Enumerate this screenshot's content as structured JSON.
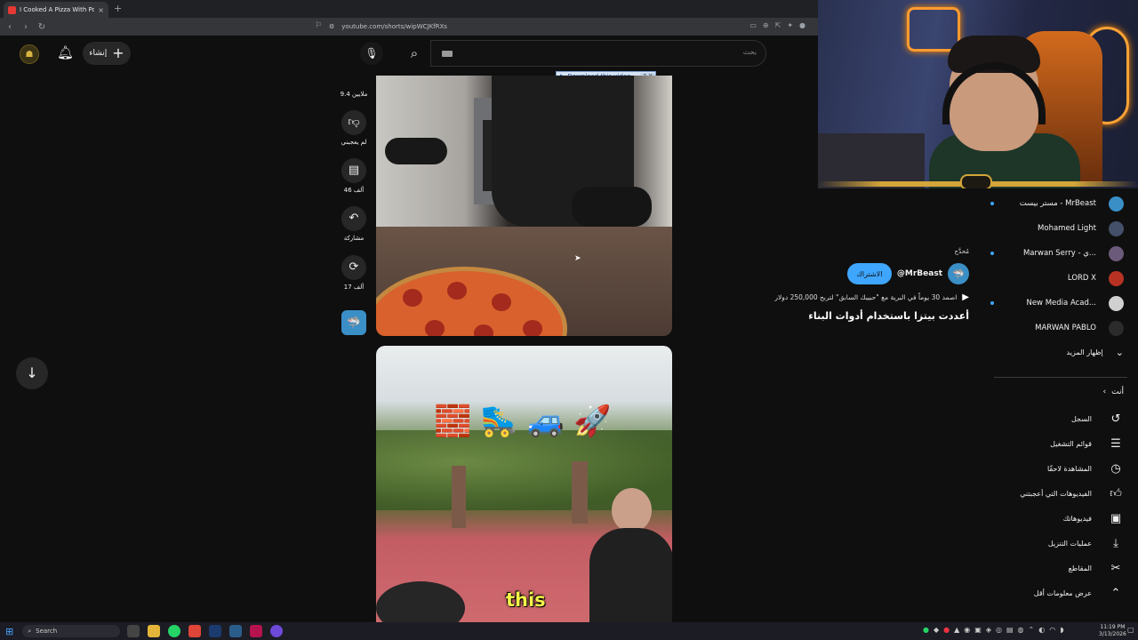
{
  "browser": {
    "tab_title": "I Cooked A Pizza With Power",
    "tab_close": "×",
    "new_tab": "+",
    "url": "youtube.com/shorts/wipWCJKfRXs",
    "nav": {
      "back": "‹",
      "forward": "›",
      "reload": "↻"
    }
  },
  "header": {
    "create_label": "إنشاء",
    "search_placeholder": "بحث"
  },
  "download_banner": {
    "label": "Download this video",
    "close": "? X"
  },
  "actions": {
    "like_count": "9.4 ملايين",
    "dislike_label": "لم يعجبني",
    "comments_count": "46 ألف",
    "share_label": "مشاركة",
    "remix_count": "17 ألف"
  },
  "video2_caption": "this",
  "video2_emojis": [
    "🧱",
    "🛼",
    "🚙",
    "🚀"
  ],
  "video_meta": {
    "nav_label": "مُحدَّج",
    "channel": "@MrBeast",
    "subscribe_label": "الاشتراك",
    "line1": "اصمد 30 يوماً في البرية مع \"حبيبك السابق\" لتربح 250,000 دولار",
    "title": "أعددت بيتزا باستخدام أدوات البناء"
  },
  "subscriptions": [
    {
      "name": "مستر بيست - MrBeast",
      "color": "#3a8fc7",
      "dot": true
    },
    {
      "name": "Mohamed Light",
      "color": "#44506a",
      "dot": false
    },
    {
      "name": "Marwan Serry - ي...",
      "color": "#6b5a7a",
      "dot": true
    },
    {
      "name": "LORD X",
      "color": "#b83224",
      "dot": false
    },
    {
      "name": "New Media Acad...",
      "color": "#d0d0d0",
      "dot": true
    },
    {
      "name": "MARWAN PABLO",
      "color": "#2b2b2b",
      "dot": false
    }
  ],
  "show_more": "إظهار المزيد",
  "you_section": {
    "header": "أنت",
    "items": [
      {
        "label": "السجل",
        "icon": "history-icon"
      },
      {
        "label": "قوائم التشغيل",
        "icon": "playlists-icon"
      },
      {
        "label": "المشاهدة لاحقًا",
        "icon": "watch-later-icon"
      },
      {
        "label": "الفيديوهات التي أعجبتني",
        "icon": "liked-icon"
      },
      {
        "label": "فيديوهاتك",
        "icon": "your-videos-icon"
      },
      {
        "label": "عمليات التنزيل",
        "icon": "downloads-icon"
      },
      {
        "label": "المقاطع",
        "icon": "clips-icon"
      },
      {
        "label": "عرض معلومات أقل",
        "icon": "chevron-up-icon"
      }
    ]
  },
  "taskbar": {
    "search_label": "Search",
    "time": "11:19 PM",
    "date": "3/13/2026"
  }
}
